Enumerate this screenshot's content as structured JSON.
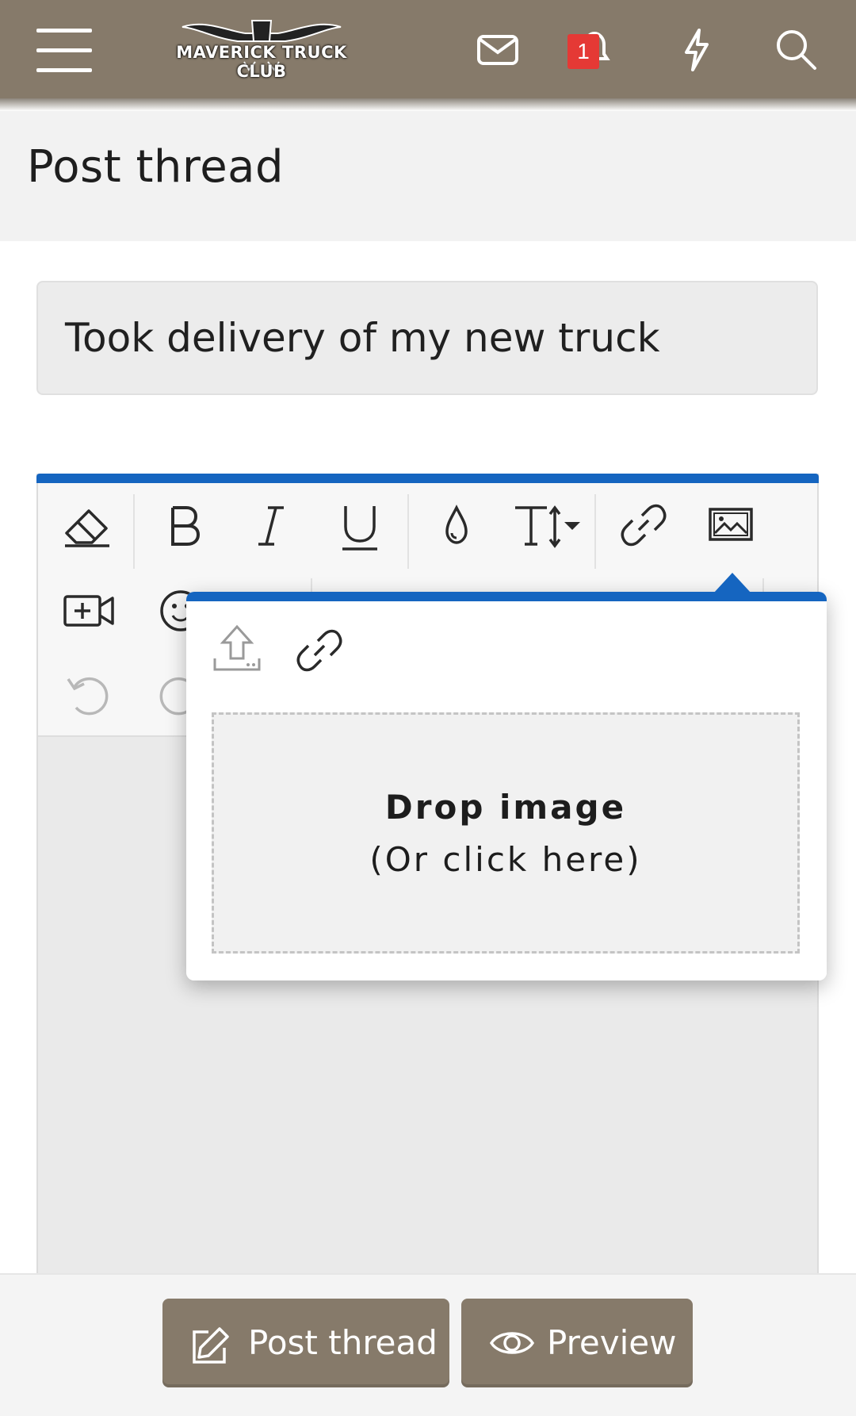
{
  "header": {
    "logo_text": "MAVERICK TRUCK CLUB",
    "notification_count": "1",
    "icons": [
      "menu-icon",
      "envelope-icon",
      "bell-icon",
      "lightning-icon",
      "search-icon"
    ],
    "color": "#867a6a"
  },
  "page": {
    "title": "Post thread"
  },
  "form": {
    "thread_title": "Took delivery of my new truck"
  },
  "editor": {
    "accent_color": "#1565c0",
    "toolbar_icons": [
      "eraser-icon",
      "bold-icon",
      "italic-icon",
      "underline-icon",
      "text-color-icon",
      "font-size-icon",
      "link-icon",
      "image-icon",
      "video-icon",
      "emoji-icon",
      "undo-icon",
      "redo-icon"
    ]
  },
  "image_popup": {
    "tabs": [
      "upload-icon",
      "link-icon"
    ],
    "drop_main": "Drop image",
    "drop_sub": "(Or click here)"
  },
  "footer": {
    "post_label": "Post thread",
    "preview_label": "Preview"
  }
}
